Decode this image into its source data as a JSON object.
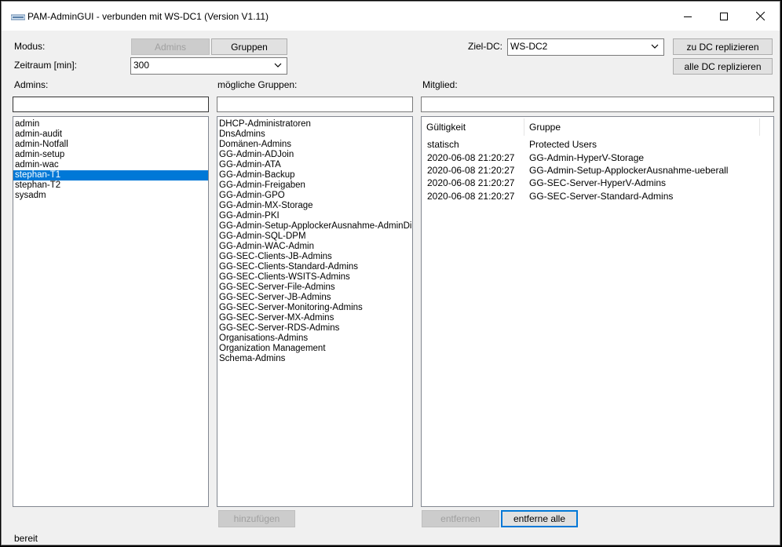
{
  "window": {
    "title": "PAM-AdminGUI - verbunden mit WS-DC1 (Version V1.11)",
    "minimize_icon": "minimize-icon",
    "maximize_icon": "maximize-icon",
    "close_icon": "close-icon"
  },
  "top": {
    "modus_label": "Modus:",
    "admins_button": "Admins",
    "gruppen_button": "Gruppen",
    "zeitraum_label": "Zeitraum [min]:",
    "zeitraum_value": "300",
    "zieldc_label": "Ziel-DC:",
    "zieldc_value": "WS-DC2",
    "replicate_dc_button": "zu DC replizieren",
    "replicate_all_button": "alle DC replizieren"
  },
  "admins": {
    "label": "Admins:",
    "filter_value": "",
    "items": [
      "admin",
      "admin-audit",
      "admin-Notfall",
      "admin-setup",
      "admin-wac",
      "stephan-T1",
      "stephan-T2",
      "sysadm"
    ],
    "selected_index": 5
  },
  "groups": {
    "label": "mögliche Gruppen:",
    "filter_value": "",
    "items": [
      "DHCP-Administratoren",
      "DnsAdmins",
      "Domänen-Admins",
      "GG-Admin-ADJoin",
      "GG-Admin-ATA",
      "GG-Admin-Backup",
      "GG-Admin-Freigaben",
      "GG-Admin-GPO",
      "GG-Admin-MX-Storage",
      "GG-Admin-PKI",
      "GG-Admin-Setup-ApplockerAusnahme-AdminDir",
      "GG-Admin-SQL-DPM",
      "GG-Admin-WAC-Admin",
      "GG-SEC-Clients-JB-Admins",
      "GG-SEC-Clients-Standard-Admins",
      "GG-SEC-Clients-WSITS-Admins",
      "GG-SEC-Server-File-Admins",
      "GG-SEC-Server-JB-Admins",
      "GG-SEC-Server-Monitoring-Admins",
      "GG-SEC-Server-MX-Admins",
      "GG-SEC-Server-RDS-Admins",
      "Organisations-Admins",
      "Organization Management",
      "Schema-Admins"
    ],
    "add_button": "hinzufügen"
  },
  "member": {
    "label": "Mitglied:",
    "filter_value": "",
    "columns": [
      "Gültigkeit",
      "Gruppe"
    ],
    "rows": [
      {
        "validity": "statisch",
        "group": "Protected Users"
      },
      {
        "validity": "2020-06-08 21:20:27",
        "group": "GG-Admin-HyperV-Storage"
      },
      {
        "validity": "2020-06-08 21:20:27",
        "group": "GG-Admin-Setup-ApplockerAusnahme-ueberall"
      },
      {
        "validity": "2020-06-08 21:20:27",
        "group": "GG-SEC-Server-HyperV-Admins"
      },
      {
        "validity": "2020-06-08 21:20:27",
        "group": "GG-SEC-Server-Standard-Admins"
      }
    ],
    "remove_button": "entfernen",
    "remove_all_button": "entferne alle"
  },
  "status": {
    "text": "bereit"
  },
  "colors": {
    "selection": "#0078d7",
    "focus_border": "#0078d7",
    "disabled_text": "#a0a0a0"
  }
}
